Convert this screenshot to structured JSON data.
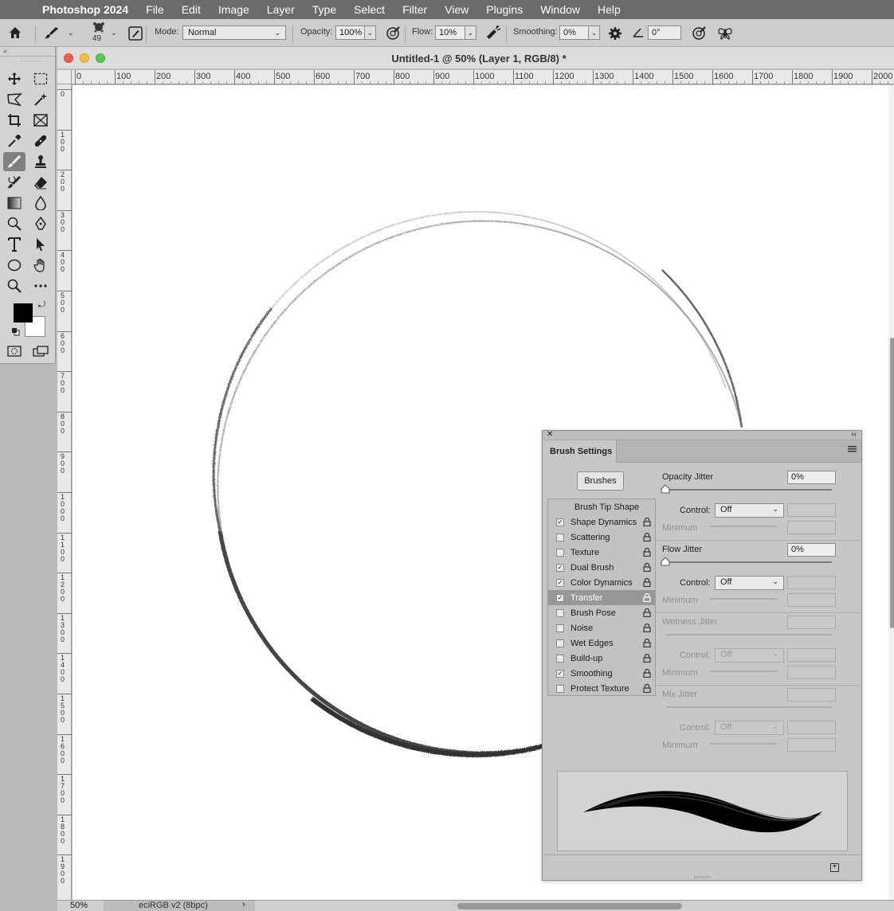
{
  "menubar": {
    "app_name": "Photoshop 2024",
    "items": [
      "File",
      "Edit",
      "Image",
      "Layer",
      "Type",
      "Select",
      "Filter",
      "View",
      "Plugins",
      "Window",
      "Help"
    ]
  },
  "options_bar": {
    "brush_size": "49",
    "mode_label": "Mode:",
    "mode_value": "Normal",
    "opacity_label": "Opacity:",
    "opacity_value": "100%",
    "flow_label": "Flow:",
    "flow_value": "10%",
    "smoothing_label": "Smoothing:",
    "smoothing_value": "0%",
    "angle_value": "0°"
  },
  "document": {
    "title": "Untitled-1 @ 50% (Layer 1, RGB/8) *",
    "ruler_top_ticks": [
      "0",
      "100",
      "200",
      "300",
      "400",
      "500",
      "600",
      "700",
      "800",
      "900",
      "1000",
      "1100",
      "1200",
      "1300",
      "1400",
      "1500",
      "1600",
      "1700",
      "1800",
      "1900",
      "2000"
    ],
    "ruler_left_ticks": [
      "0",
      "100",
      "200",
      "300",
      "400",
      "500",
      "600",
      "700",
      "800",
      "900",
      "1000",
      "1100",
      "1200",
      "1300",
      "1400",
      "1500",
      "1600",
      "1700",
      "1800",
      "1900"
    ],
    "zoom": "50%",
    "color_profile": "eciRGB v2 (8bpc)"
  },
  "brush_panel": {
    "tab_title": "Brush Settings",
    "brushes_button": "Brushes",
    "tip_shape_label": "Brush Tip Shape",
    "options": [
      {
        "label": "Shape Dynamics",
        "checked": true,
        "active": false
      },
      {
        "label": "Scattering",
        "checked": false,
        "active": false
      },
      {
        "label": "Texture",
        "checked": false,
        "active": false
      },
      {
        "label": "Dual Brush",
        "checked": true,
        "active": false
      },
      {
        "label": "Color Dynamics",
        "checked": true,
        "active": false
      },
      {
        "label": "Transfer",
        "checked": true,
        "active": true
      },
      {
        "label": "Brush Pose",
        "checked": false,
        "active": false
      },
      {
        "label": "Noise",
        "checked": false,
        "active": false
      },
      {
        "label": "Wet Edges",
        "checked": false,
        "active": false
      },
      {
        "label": "Build-up",
        "checked": false,
        "active": false
      },
      {
        "label": "Smoothing",
        "checked": true,
        "active": false
      },
      {
        "label": "Protect Texture",
        "checked": false,
        "active": false
      }
    ],
    "sections": [
      {
        "title": "Opacity Jitter",
        "value": "0%",
        "control_label": "Control:",
        "control_value": "Off",
        "minimum_label": "Minimum",
        "enabled": true
      },
      {
        "title": "Flow Jitter",
        "value": "0%",
        "control_label": "Control:",
        "control_value": "Off",
        "minimum_label": "Minimum",
        "enabled": true
      },
      {
        "title": "Wetness Jitter",
        "value": "",
        "control_label": "Control:",
        "control_value": "Off",
        "minimum_label": "Minimum",
        "enabled": false
      },
      {
        "title": "Mix Jitter",
        "value": "",
        "control_label": "Control:",
        "control_value": "Off",
        "minimum_label": "Minimum",
        "enabled": false
      }
    ]
  }
}
